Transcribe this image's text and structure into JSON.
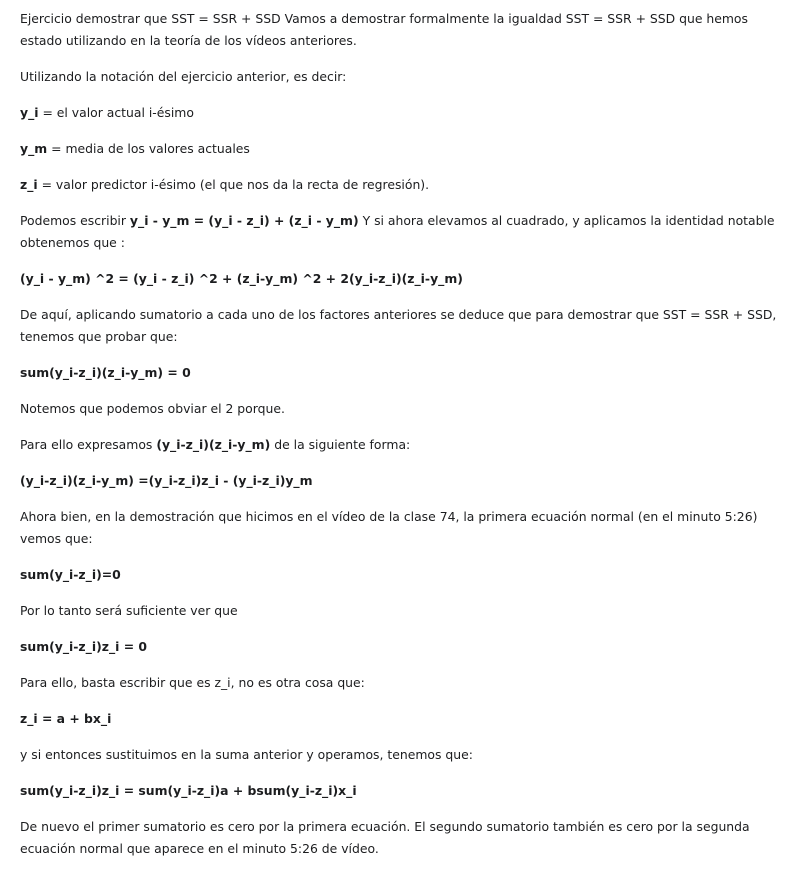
{
  "paragraphs": {
    "p1": "Ejercicio demostrar que SST = SSR + SSD Vamos a demostrar formalmente la igualdad SST = SSR + SSD que hemos estado utilizando en la teoría de los vídeos anteriores.",
    "p2": "Utilizando la notación del ejercicio anterior, es decir:",
    "p3_term": "y_i",
    "p3_rest": " = el valor actual i-ésimo",
    "p4_term": "y_m",
    "p4_rest": " = media de los valores actuales",
    "p5_term": "z_i",
    "p5_rest": " = valor predictor i-ésimo (el que nos da la recta de regresión).",
    "p6_a": "Podemos escribir ",
    "p6_b": "y_i - y_m = (y_i - z_i) + (z_i - y_m)",
    "p6_c": " Y si ahora elevamos al cuadrado, y aplicamos la identidad notable obtenemos que :",
    "p7": "(y_i - y_m) ^2 = (y_i - z_i) ^2 + (z_i-y_m) ^2 + 2(y_i-z_i)(z_i-y_m)",
    "p8": "De aquí, aplicando sumatorio a cada uno de los factores anteriores se deduce que para demostrar que SST = SSR + SSD, tenemos que probar que:",
    "p9": "sum(y_i-z_i)(z_i-y_m) = 0",
    "p10": "Notemos que podemos obviar el 2 porque.",
    "p11_a": "Para ello expresamos ",
    "p11_b": "(y_i-z_i)(z_i-y_m)",
    "p11_c": " de la siguiente forma:",
    "p12": "(y_i-z_i)(z_i-y_m) =(y_i-z_i)z_i - (y_i-z_i)y_m",
    "p13": "Ahora bien, en la demostración que hicimos en el vídeo de la clase 74, la primera ecuación normal (en el minuto 5:26) vemos que:",
    "p14": "sum(y_i-z_i)=0",
    "p15": "Por lo tanto será suficiente ver que",
    "p16": "sum(y_i-z_i)z_i = 0",
    "p17": "Para ello, basta escribir que es z_i, no es otra cosa que:",
    "p18": "z_i = a + bx_i",
    "p19": "y si entonces sustituimos en la suma anterior y operamos, tenemos que:",
    "p20": "sum(y_i-z_i)z_i = sum(y_i-z_i)a + bsum(y_i-z_i)x_i",
    "p21": "De nuevo el primer sumatorio es cero por la primera ecuación. El segundo sumatorio también es cero por la segunda ecuación normal que aparece en el minuto 5:26 de vídeo."
  }
}
